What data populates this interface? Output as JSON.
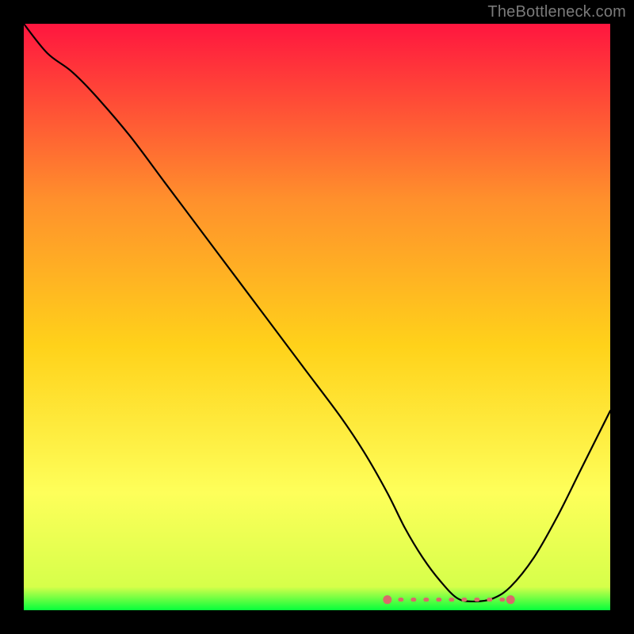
{
  "watermark": "TheBottleneck.com",
  "colors": {
    "bg": "#000000",
    "grad_top": "#ff163f",
    "grad_mid1": "#ff6a2c",
    "grad_mid2": "#ffd21a",
    "grad_mid3": "#feff5a",
    "grad_bottom": "#05ff3c",
    "curve": "#000000",
    "marker": "#d86a6a"
  },
  "chart_data": {
    "type": "line",
    "title": "",
    "xlabel": "",
    "ylabel": "",
    "xlim": [
      0,
      100
    ],
    "ylim": [
      0,
      100
    ],
    "grid": false,
    "note": "Values are percentages of the plot area width (x) and height (y); y is bottleneck-like metric where 0 is the bottom (green) and 100 is the top (red).",
    "series": [
      {
        "name": "curve",
        "x": [
          0,
          4,
          8,
          12,
          18,
          24,
          30,
          36,
          42,
          48,
          54,
          58,
          62,
          65,
          68,
          71,
          74,
          77,
          80,
          83,
          87,
          91,
          95,
          100
        ],
        "y": [
          100,
          95,
          92,
          88,
          81,
          73,
          65,
          57,
          49,
          41,
          33,
          27,
          20,
          14,
          9,
          5,
          2,
          1.5,
          2,
          4,
          9,
          16,
          24,
          34
        ]
      }
    ],
    "marker_band": {
      "x_start": 62,
      "x_end": 83,
      "y": 1.8,
      "description": "dotted coral segment highlighting the trough of the curve"
    }
  }
}
